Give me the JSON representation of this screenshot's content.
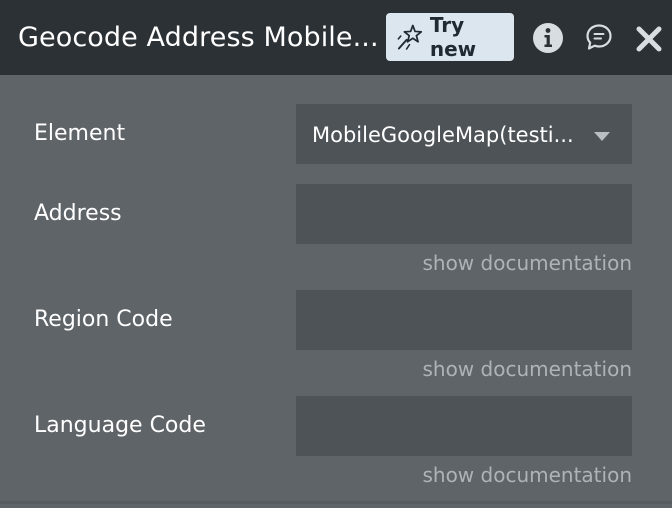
{
  "header": {
    "title": "Geocode Address Mobile...",
    "try_new_label": "Try new",
    "icons": {
      "try_new": "magic-wand-icon",
      "info": "info-icon",
      "comment": "comment-icon",
      "close": "close-icon"
    }
  },
  "fields": {
    "element": {
      "label": "Element",
      "value": "MobileGoogleMap(testi...",
      "icon": "caret-down-icon"
    },
    "address": {
      "label": "Address",
      "value": "",
      "doc_link": "show documentation"
    },
    "region_code": {
      "label": "Region Code",
      "value": "",
      "doc_link": "show documentation"
    },
    "language_code": {
      "label": "Language Code",
      "value": "",
      "doc_link": "show documentation"
    }
  },
  "colors": {
    "header_bg": "#2c3135",
    "panel_bg": "#5f6469",
    "field_bg": "#4e5357",
    "try_new_bg": "#dce6ef",
    "link_text": "#aeb3b7"
  }
}
